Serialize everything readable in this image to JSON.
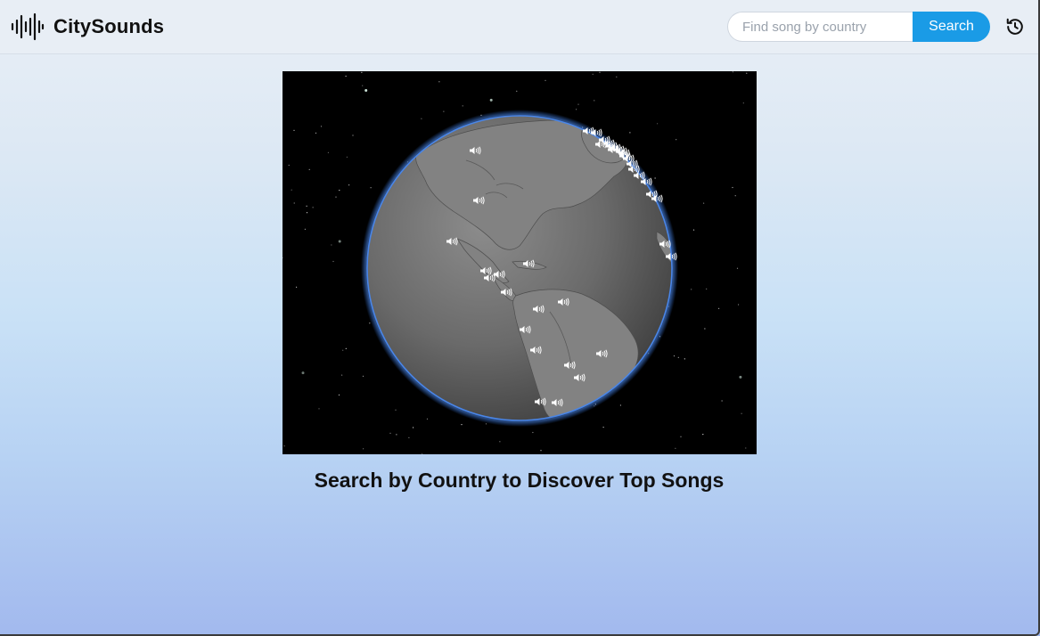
{
  "app": {
    "name": "CitySounds"
  },
  "search": {
    "placeholder": "Find song by country",
    "button_label": "Search"
  },
  "globe": {
    "marker_icon": "speaker-icon",
    "marker_count": 38,
    "colors": {
      "space": "#000000",
      "globe": "#6a6a6a",
      "atmosphere": "#3b82f6",
      "marker": "#ffffff"
    }
  },
  "main": {
    "tagline": "Search by Country to Discover Top Songs"
  },
  "colors": {
    "accent": "#1a9be6",
    "header_bg": "#e8eef5",
    "text": "#111111"
  }
}
